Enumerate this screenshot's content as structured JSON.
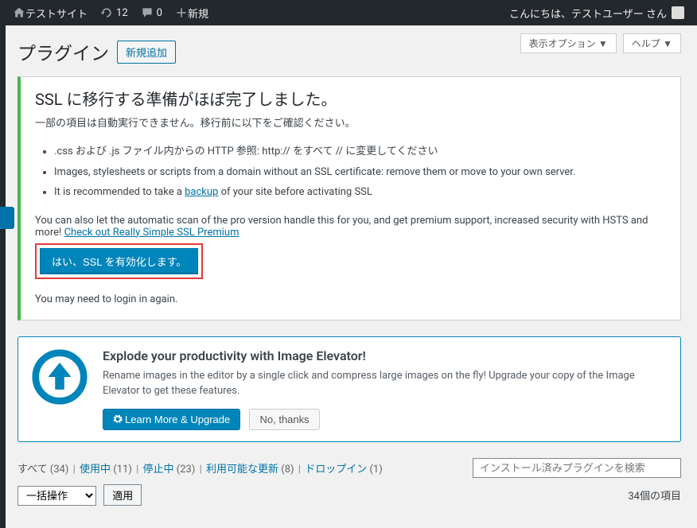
{
  "adminbar": {
    "site_name": "テストサイト",
    "updates_count": "12",
    "comments_count": "0",
    "new_label": "新規",
    "greeting": "こんにちは、テストユーザー さん"
  },
  "top_buttons": {
    "screen_options": "表示オプション ▼",
    "help": "ヘルプ ▼"
  },
  "page": {
    "title": "プラグイン",
    "add_new": "新規追加"
  },
  "ssl_notice": {
    "heading": "SSL に移行する準備がほぼ完了しました。",
    "subtext": "一部の項目は自動実行できません。移行前に以下をご確認ください。",
    "items": [
      ".css および .js ファイル内からの HTTP 参照: http:// をすべて // に変更してください",
      "Images, stylesheets or scripts from a domain without an SSL certificate: remove them or move to your own server.",
      "It is recommended to take a "
    ],
    "backup_link": "backup",
    "item2_tail": " of your site before activating SSL",
    "pro_text1": "You can also let the automatic scan of the pro version handle this for you, and get premium support, increased security with HSTS and more!  ",
    "pro_link": "Check out Really Simple SSL Premium",
    "button": "はい、SSL を有効化します。",
    "relogin": "You may need to login in again."
  },
  "promo": {
    "heading": "Explode your productivity with Image Elevator!",
    "text": "Rename images in the editor by a single click and compress large images on the fly! Upgrade your copy of the Image Elevator to get these features.",
    "primary": "Learn More & Upgrade",
    "secondary": "No, thanks"
  },
  "filters": {
    "all": "すべて ",
    "all_count": "(34)",
    "active": "使用中 ",
    "active_count": "(11)",
    "inactive": "停止中 ",
    "inactive_count": "(23)",
    "updates": "利用可能な更新 ",
    "updates_count": "(8)",
    "dropins": "ドロップイン ",
    "dropins_count": "(1)",
    "search_placeholder": "インストール済みプラグインを検索"
  },
  "bulk": {
    "select": "一括操作",
    "apply": "適用",
    "count": "34個の項目"
  }
}
